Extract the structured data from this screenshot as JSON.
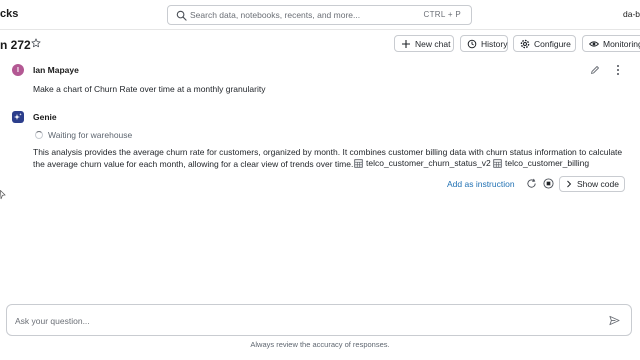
{
  "header": {
    "brand_partial": "cks",
    "search_placeholder": "Search data, notebooks, recents, and more...",
    "search_shortcut": "CTRL + P",
    "workspace_partial": "da-b"
  },
  "titlebar": {
    "title_partial": "n 272",
    "buttons": {
      "new_chat": "New chat",
      "history": "History",
      "configure": "Configure",
      "monitoring": "Monitoring"
    }
  },
  "conversation": {
    "user": {
      "initial": "I",
      "name": "Ian Mapaye",
      "message": "Make a chart of Churn Rate over time at a monthly granularity"
    },
    "genie": {
      "name": "Genie",
      "status": "Waiting for warehouse",
      "description_line1": "This analysis provides the average churn rate for customers, organized by month. It combines customer billing data with churn status information to calculate",
      "description_line2": "the average churn value for each month, allowing for a clear view of trends over time.",
      "tables": [
        "telco_customer_churn_status_v2",
        "telco_customer_billing"
      ],
      "actions": {
        "add_instruction": "Add as instruction",
        "show_code": "Show code"
      }
    }
  },
  "composer": {
    "placeholder": "Ask your question...",
    "disclaimer": "Always review the accuracy of responses."
  },
  "colors": {
    "accent": "#2272b4",
    "user_avatar": "#b35893",
    "genie_avatar": "#2c3e8c",
    "border": "#c9ccd1"
  },
  "icons": [
    "search-icon",
    "star-icon",
    "plus-icon",
    "history-icon",
    "gear-icon",
    "eye-icon",
    "pencil-icon",
    "kebab-icon",
    "sparkle-icon",
    "table-icon",
    "refresh-icon",
    "stop-icon",
    "chevron-right-icon",
    "send-icon",
    "cursor-icon"
  ]
}
